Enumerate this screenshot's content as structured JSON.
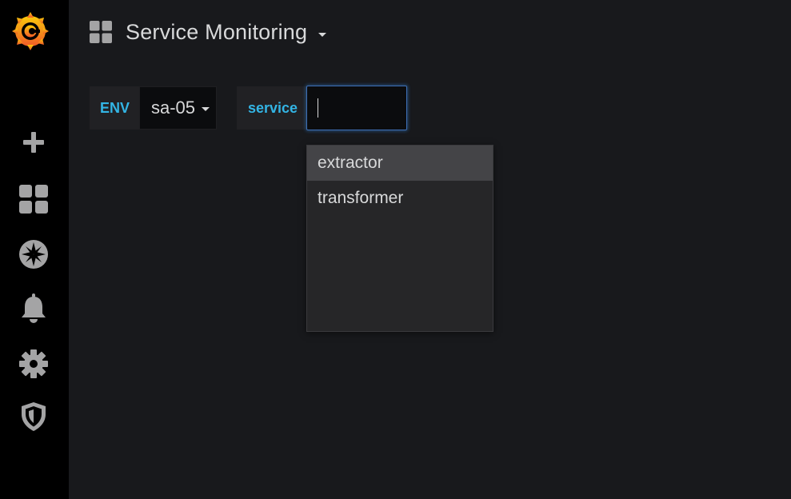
{
  "sidebar": {
    "logo": "grafana-logo",
    "items": [
      {
        "icon": "plus-icon",
        "name": "create"
      },
      {
        "icon": "dashboards-icon",
        "name": "dashboards"
      },
      {
        "icon": "compass-icon",
        "name": "explore"
      },
      {
        "icon": "bell-icon",
        "name": "alerting"
      },
      {
        "icon": "gear-icon",
        "name": "configuration"
      },
      {
        "icon": "shield-icon",
        "name": "server-admin"
      }
    ]
  },
  "header": {
    "icon": "dashboard-grid-icon",
    "title": "Service Monitoring"
  },
  "variables": {
    "env": {
      "label": "ENV",
      "value": "sa-05"
    },
    "service": {
      "label": "service",
      "value": "",
      "options": [
        "extractor",
        "transformer"
      ],
      "highlighted_index": 0
    }
  },
  "colors": {
    "accent_label": "#33b5e5",
    "sidebar_bg": "#000000",
    "main_bg": "#18191c",
    "focus_border": "#3f6fb5"
  }
}
